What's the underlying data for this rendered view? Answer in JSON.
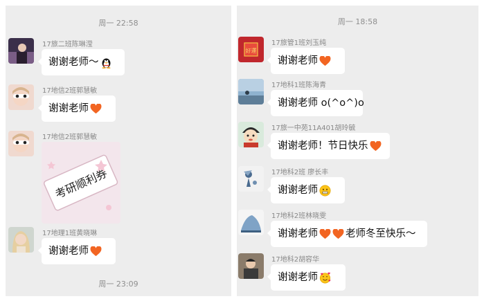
{
  "left": {
    "timestamps": [
      "周一 22:58",
      "周一 23:09"
    ],
    "messages": [
      {
        "sender": "17旅二班陈琳滢",
        "text": "谢谢老师～",
        "icons": [
          "qq-penguin-icon"
        ]
      },
      {
        "sender": "17地信2班郭慧敏",
        "text": "谢谢老师",
        "icons": [
          "heart-icon"
        ]
      },
      {
        "sender": "17地信2班郭慧敏",
        "sticker_text": "考研顺利券"
      },
      {
        "sender": "17地理1班黄晓琳",
        "text": "谢谢老师",
        "icons": [
          "heart-icon"
        ]
      }
    ]
  },
  "right": {
    "timestamps": [
      "周一 18:58"
    ],
    "messages": [
      {
        "sender": "17旅管1班刘玉纯",
        "text": "谢谢老师",
        "icons": [
          "heart-icon"
        ],
        "avatar_text": "好運"
      },
      {
        "sender": "17地科1班陈海青",
        "text": "谢谢老师 o(^o^)o",
        "icons": []
      },
      {
        "sender": "17旅一中苑11A401胡玲毓",
        "text": "谢谢老师！节日快乐",
        "icons": [
          "heart-icon"
        ]
      },
      {
        "sender": "17地科2班  廖长丰",
        "text": "谢谢老师",
        "icons": [
          "grin-face-icon"
        ]
      },
      {
        "sender": "17地科2班林晓雯",
        "text": "谢谢老师",
        "text2": "老师冬至快乐～",
        "icons": [
          "heart-icon",
          "heart-icon"
        ]
      },
      {
        "sender": "17地科2胡容华",
        "text": "谢谢老师",
        "icons": [
          "smiling-face-hearts-icon"
        ]
      }
    ]
  },
  "colors": {
    "panel_bg": "#ededed",
    "bubble_bg": "#ffffff",
    "heart": "#f26522",
    "meta_text": "#888888"
  }
}
